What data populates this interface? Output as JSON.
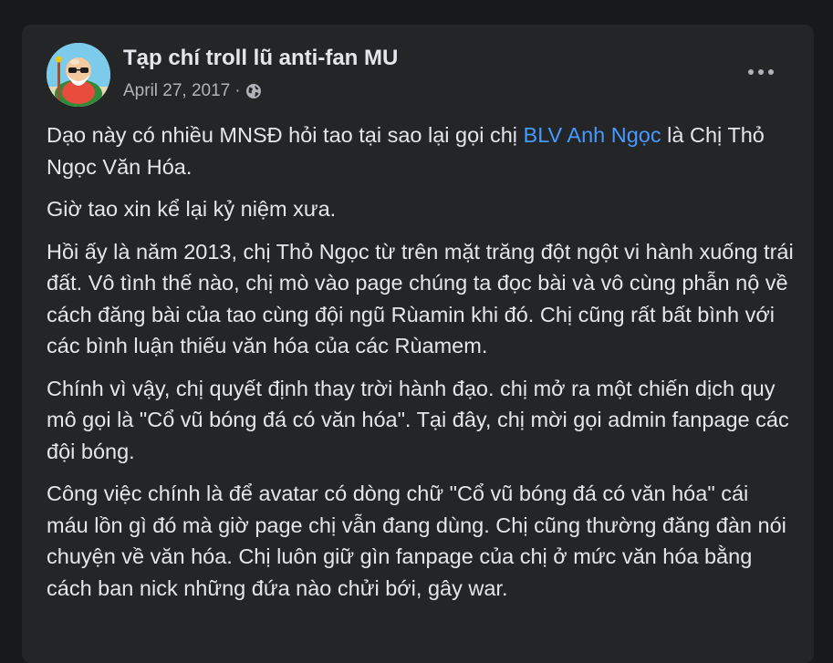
{
  "post": {
    "page_name": "Tạp chí troll lũ anti-fan MU",
    "date": "April 27, 2017",
    "separator": "·",
    "privacy_icon": "globe-icon",
    "more_icon": "more-horizontal-icon",
    "avatar_icon": "cartoon-character-avatar"
  },
  "content": {
    "p1_before": "Dạo này có nhiều MNSĐ hỏi tao tại sao lại gọi chị ",
    "p1_link": "BLV Anh Ngọc",
    "p1_after": " là Chị Thỏ Ngọc Văn Hóa.",
    "p2": "Giờ tao xin kể lại kỷ niệm xưa.",
    "p3": "Hồi ấy là năm 2013, chị Thỏ Ngọc từ trên mặt trăng đột ngột vi hành xuống trái đất. Vô tình thế nào, chị mò vào page chúng ta đọc bài và vô cùng phẫn nộ về cách đăng bài của tao cùng đội ngũ Rùamin khi đó. Chị cũng rất bất bình với các bình luận thiếu văn hóa của các Rùamem.",
    "p4": "Chính vì vậy, chị quyết định thay trời hành đạo. chị mở ra một chiến dịch quy mô gọi là \"Cổ vũ bóng đá có văn hóa\". Tại đây, chị mời gọi admin fanpage các đội bóng.",
    "p5": "Công việc chính là để avatar có dòng chữ \"Cổ vũ bóng đá có văn hóa\" cái máu lồn gì đó mà giờ page chị vẫn đang dùng. Chị cũng thường đăng đàn nói chuyện về văn hóa. Chị luôn giữ gìn fanpage của chị ở mức văn hóa bằng cách ban nick những đứa nào chửi bới, gây war."
  },
  "colors": {
    "background": "#18191a",
    "card": "#242526",
    "text": "#e4e6eb",
    "secondary_text": "#b0b3b8",
    "link": "#4599ff"
  }
}
